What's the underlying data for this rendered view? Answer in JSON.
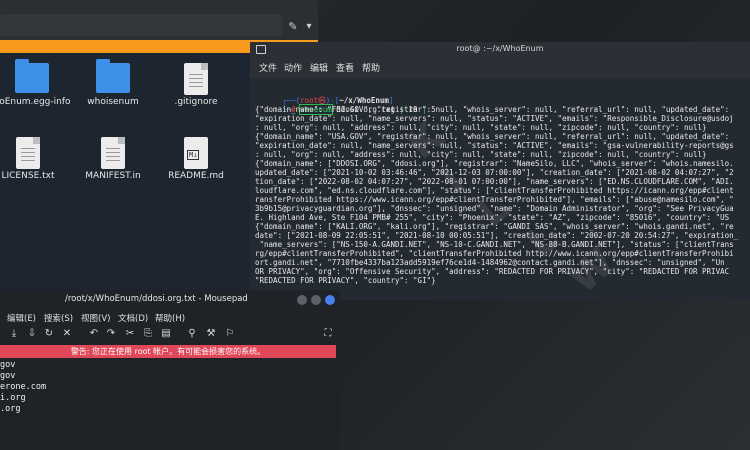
{
  "file_manager": {
    "items": [
      {
        "name": "hoEnum.egg-info",
        "icon": "folder-icon"
      },
      {
        "name": "whoisenum",
        "icon": "folder-icon"
      },
      {
        "name": ".gitignore",
        "icon": "text-file-icon"
      },
      {
        "name": "LICENSE.txt",
        "icon": "text-file-icon"
      },
      {
        "name": "MANIFEST.in",
        "icon": "text-file-icon"
      },
      {
        "name": "README.md",
        "icon": "markdown-file-icon"
      }
    ],
    "edit_icon": "✎",
    "chevron_icon": "▾"
  },
  "terminal": {
    "title": "root@ :~/x/WhoEnum",
    "menu": [
      "文件",
      "动作",
      "编辑",
      "查看",
      "帮助"
    ],
    "prompt": {
      "open": "┌──(",
      "user": "root",
      "at": "㉿",
      "host": "",
      "close": ")-[",
      "path": "~/x/WhoEnum",
      "end": "]",
      "line2": "└─",
      "hash": "#",
      "command": "whoenum",
      "args": " ddosi.org.txt ",
      "pipe_arrow": "|",
      "arg2": " 10 ",
      "pipe2": "|",
      "arg3": " 5"
    },
    "output_lines": [
      "{\"domain_name\": \"FBI.GOV\", \"registrar\": null, \"whois_server\": null, \"referral_url\": null, \"updated_date\":",
      "\"expiration_date\": null, \"name_servers\": null, \"status\": \"ACTIVE\", \"emails\": \"Responsible_Disclosure@usdoj",
      ": null, \"org\": null, \"address\": null, \"city\": null, \"state\": null, \"zipcode\": null, \"country\": null}",
      "{\"domain_name\": \"USA.GOV\", \"registrar\": null, \"whois_server\": null, \"referral_url\": null, \"updated_date\":",
      "\"expiration_date\": null, \"name_servers\": null, \"status\": \"ACTIVE\", \"emails\": \"gsa-vulnerability-reports@gs",
      ": null, \"org\": null, \"address\": null, \"city\": null, \"state\": null, \"zipcode\": null, \"country\": null}",
      "{\"domain_name\": [\"DDOSI.ORG\", \"ddosi.org\"], \"registrar\": \"NameSilo, LLC\", \"whois_server\": \"whois.namesilo.",
      "updated_date\": [\"2021-10-02 03:46:46\", \"2021-12-03 07:00:00\"], \"creation_date\": [\"2021-08-02 04:07:27\", \"2",
      "tion_date\": [\"2022-08-02 04:07:27\", \"2022-08-01 07:00:00\"], \"name_servers\": [\"ED.NS.CLOUDFLARE.COM\", \"ADI.",
      "loudflare.com\", \"ed.ns.cloudflare.com\"], \"status\": [\"clientTransferProhibited https://icann.org/epp#client",
      "ransferProhibited https://www.icann.org/epp#clientTransferProhibited\"], \"emails\": [\"abuse@namesilo.com\", \"",
      "3b9b15@privacyguardian.org\"], \"dnssec\": \"unsigned\", \"name\": \"Domain Administrator\", \"org\": \"See PrivacyGua",
      "E. Highland Ave, Ste F104 PMB# 255\", \"city\": \"Phoenix\", \"state\": \"AZ\", \"zipcode\": \"85016\", \"country\": \"US",
      "{\"domain_name\": [\"KALI.ORG\", \"kali.org\"], \"registrar\": \"GANDI SAS\", \"whois_server\": \"whois.gandi.net\", \"re",
      "date\": [\"2021-08-09 22:05:51\", \"2021-08-10 00:05:51\"], \"creation_date\": \"2002-07-20 20:54:27\", \"expiration_",
      " \"name_servers\": [\"NS-150-A.GANDI.NET\", \"NS-10-C.GANDI.NET\", \"NS-88-B.GANDI.NET\"], \"status\": [\"clientTrans",
      "rg/epp#clientTransferProhibited\", \"clientTransferProhibited http://www.icann.org/epp#clientTransferProhibi",
      "ort.gandi.net\", \"7710fbe4337ba123add5919ef76ce1d4-1484962@contact.gandi.net\"], \"dnssec\": \"unsigned\", \"Un",
      "OR PRIVACY\", \"org\": \"Offensive Security\", \"address\": \"REDACTED FOR PRIVACY\", \"city\": \"REDACTED FOR PRIVAC",
      "\"REDACTED FOR PRIVACY\", \"country\": \"GI\"}"
    ]
  },
  "mousepad": {
    "title": "/root/x/WhoEnum/ddosi.org.txt - Mousepad",
    "menu": [
      "编辑(E)",
      "搜索(S)",
      "视图(V)",
      "文档(D)",
      "帮助(H)"
    ],
    "toolbar_icons": [
      "save-icon",
      "save-as-icon",
      "reload-icon",
      "close-icon",
      "undo-icon",
      "redo-icon",
      "cut-icon",
      "copy-icon",
      "paste-icon",
      "find-icon",
      "find-replace-icon",
      "goto-icon",
      "fullscreen-icon"
    ],
    "toolbar_glyphs": [
      "⤓",
      "⇩",
      "↻",
      "✕",
      "↶",
      "↷",
      "✂",
      "⎘",
      "▤",
      "⚲",
      "⚒",
      "⚐",
      "⛶"
    ],
    "warning": "警告: 您正在使用 root 帐户。有可能会损害您的系统。",
    "lines": [
      "gov",
      "gov",
      "erone.com",
      "i.org",
      ".org"
    ]
  },
  "colors": {
    "accent_orange": "#f79a1e",
    "warning_red": "#e04758",
    "terminal_bg": "#242a31",
    "prompt_green": "#3fd16b"
  }
}
